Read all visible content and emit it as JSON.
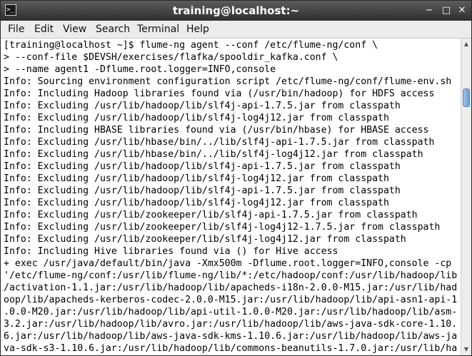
{
  "window": {
    "title": "training@localhost:~",
    "icon": "terminal-icon",
    "controls": {
      "minimize": "−",
      "maximize": "□",
      "close": "✕"
    }
  },
  "menu": [
    "File",
    "Edit",
    "View",
    "Search",
    "Terminal",
    "Help"
  ],
  "terminal": {
    "lines": [
      "[training@localhost ~]$ flume-ng agent --conf /etc/flume-ng/conf \\",
      "> --conf-file $DEVSH/exercises/flafka/spooldir_kafka.conf \\",
      "> --name agent1 -Dflume.root.logger=INFO,console",
      "Info: Sourcing environment configuration script /etc/flume-ng/conf/flume-env.sh",
      "Info: Including Hadoop libraries found via (/usr/bin/hadoop) for HDFS access",
      "Info: Excluding /usr/lib/hadoop/lib/slf4j-api-1.7.5.jar from classpath",
      "Info: Excluding /usr/lib/hadoop/lib/slf4j-log4j12.jar from classpath",
      "Info: Including HBASE libraries found via (/usr/bin/hbase) for HBASE access",
      "Info: Excluding /usr/lib/hbase/bin/../lib/slf4j-api-1.7.5.jar from classpath",
      "Info: Excluding /usr/lib/hbase/bin/../lib/slf4j-log4j12.jar from classpath",
      "Info: Excluding /usr/lib/hadoop/lib/slf4j-api-1.7.5.jar from classpath",
      "Info: Excluding /usr/lib/hadoop/lib/slf4j-log4j12.jar from classpath",
      "Info: Excluding /usr/lib/hadoop/lib/slf4j-api-1.7.5.jar from classpath",
      "Info: Excluding /usr/lib/hadoop/lib/slf4j-log4j12.jar from classpath",
      "Info: Excluding /usr/lib/zookeeper/lib/slf4j-api-1.7.5.jar from classpath",
      "Info: Excluding /usr/lib/zookeeper/lib/slf4j-log4j12-1.7.5.jar from classpath",
      "Info: Excluding /usr/lib/zookeeper/lib/slf4j-log4j12.jar from classpath",
      "Info: Including Hive libraries found via () for Hive access",
      "+ exec /usr/java/default/bin/java -Xmx500m -Dflume.root.logger=INFO,console -cp",
      "'/etc/flume-ng/conf:/usr/lib/flume-ng/lib/*:/etc/hadoop/conf:/usr/lib/hadoop/lib",
      "/activation-1.1.jar:/usr/lib/hadoop/lib/apacheds-i18n-2.0.0-M15.jar:/usr/lib/had",
      "oop/lib/apacheds-kerberos-codec-2.0.0-M15.jar:/usr/lib/hadoop/lib/api-asn1-api-1",
      ".0.0-M20.jar:/usr/lib/hadoop/lib/api-util-1.0.0-M20.jar:/usr/lib/hadoop/lib/asm-",
      "3.2.jar:/usr/lib/hadoop/lib/avro.jar:/usr/lib/hadoop/lib/aws-java-sdk-core-1.10.",
      "6.jar:/usr/lib/hadoop/lib/aws-java-sdk-kms-1.10.6.jar:/usr/lib/hadoop/lib/aws-ja",
      "va-sdk-s3-1.10.6.jar:/usr/lib/hadoop/lib/commons-beanutils-1.7.0.jar:/usr/lib/ha"
    ]
  },
  "scrollbar": {
    "up_icon": "arrow-up-icon",
    "down_icon": "arrow-down-icon"
  }
}
